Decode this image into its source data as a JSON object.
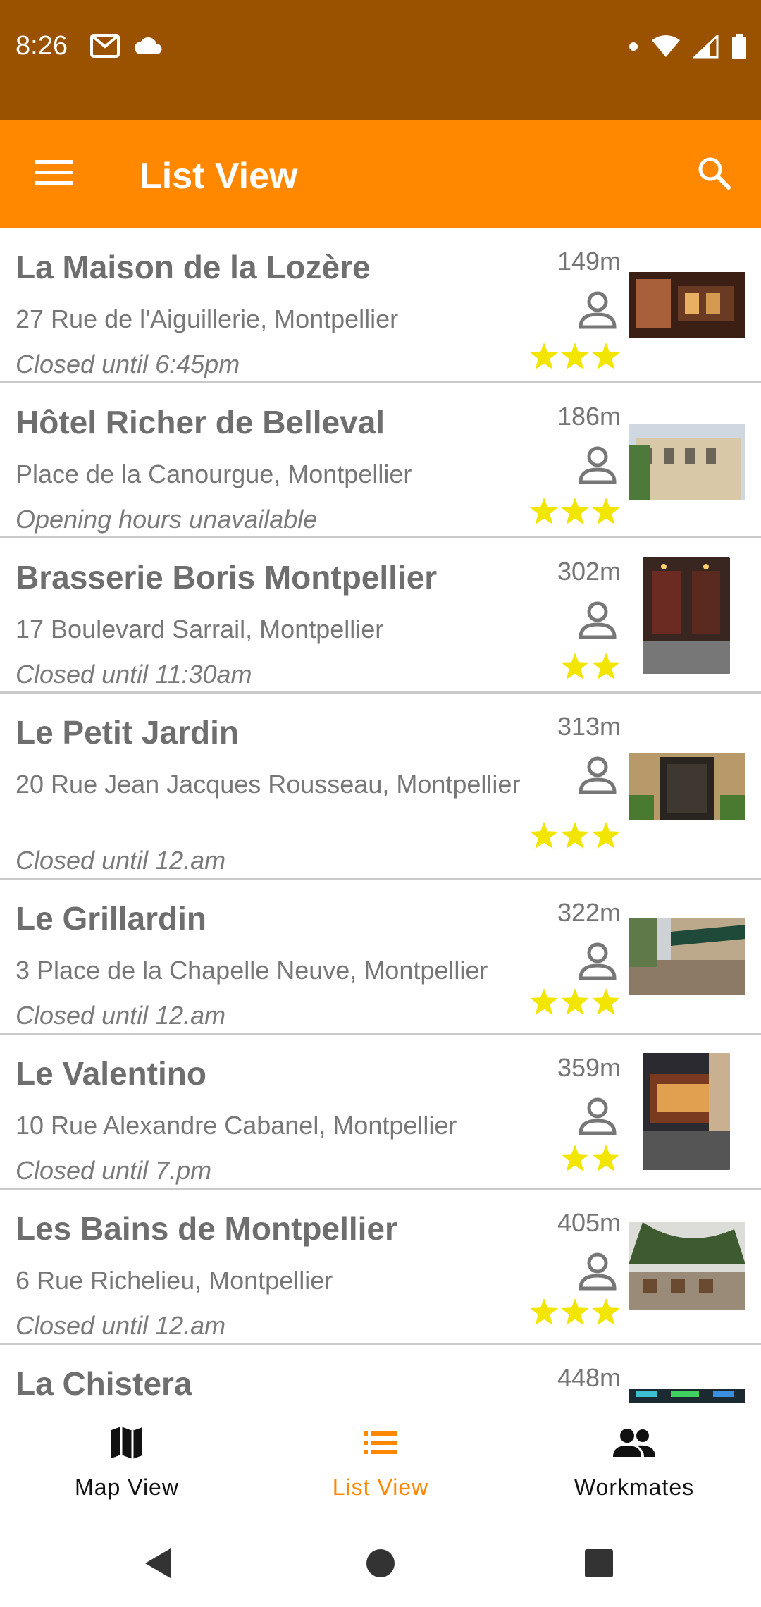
{
  "status_bar": {
    "time": "8:26"
  },
  "toolbar": {
    "title": "List View"
  },
  "colors": {
    "accent": "#FF8800",
    "status": "#9A5200",
    "star": "#F2E600"
  },
  "restaurants": [
    {
      "name": "La Maison de la Lozère",
      "address": "27 Rue de l'Aiguillerie, Montpellier",
      "hours": "Closed until 6:45pm",
      "distance": "149m",
      "stars": 3
    },
    {
      "name": "Hôtel Richer de Belleval",
      "address": "Place de la Canourgue, Montpellier",
      "hours": "Opening hours unavailable",
      "distance": "186m",
      "stars": 3
    },
    {
      "name": "Brasserie Boris Montpellier",
      "address": "17 Boulevard Sarrail, Montpellier",
      "hours": "Closed until 11:30am",
      "distance": "302m",
      "stars": 2
    },
    {
      "name": "Le Petit Jardin",
      "address": "20 Rue Jean Jacques Rousseau, Montpellier",
      "hours": "Closed until 12.am",
      "distance": "313m",
      "stars": 3
    },
    {
      "name": "Le Grillardin",
      "address": "3 Place de la Chapelle Neuve, Montpellier",
      "hours": "Closed until 12.am",
      "distance": "322m",
      "stars": 3
    },
    {
      "name": "Le Valentino",
      "address": "10 Rue Alexandre Cabanel, Montpellier",
      "hours": "Closed until 7.pm",
      "distance": "359m",
      "stars": 2
    },
    {
      "name": "Les Bains de Montpellier",
      "address": "6 Rue Richelieu, Montpellier",
      "hours": "Closed until 12.am",
      "distance": "405m",
      "stars": 3
    },
    {
      "name": "La Chistera",
      "distance": "448m"
    }
  ],
  "bottom_nav": {
    "map_label": "Map View",
    "list_label": "List View",
    "workmates_label": "Workmates"
  }
}
